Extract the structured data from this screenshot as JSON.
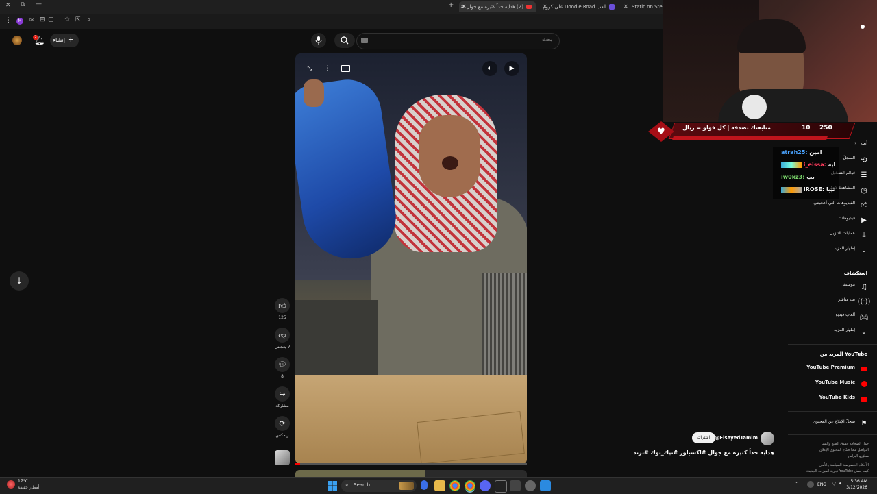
{
  "browser": {
    "tabs": [
      {
        "title": "Static on Steam"
      },
      {
        "title": "العب Doodle Road على كروم"
      },
      {
        "title": "(2) هدايه جداً كثيره مع جوال #اك..."
      }
    ],
    "new_tab": "+",
    "minimize": "—",
    "close": "✕"
  },
  "header": {
    "search_placeholder": "بحث",
    "create_label": "إنشاء",
    "notifications_count": "2"
  },
  "actions": {
    "like_count": "125",
    "dislike_label": "لا يعجبني",
    "comment_count": "8",
    "share_label": "مشاركة",
    "remix_label": "ريمكس"
  },
  "overlay": {
    "text": "متابعتك بصدقة | كل فولو = ريال",
    "count": "10",
    "total": "250"
  },
  "chat": [
    {
      "user": "atrah25:",
      "msg": "امين",
      "color": "#4aa3ff"
    },
    {
      "user": "i_eissa:",
      "msg": "ايه",
      "color": "#ff3b5c"
    },
    {
      "user": "iw0kz3:",
      "msg": "بب",
      "color": "#7bd66b"
    },
    {
      "user": "IROSE:",
      "msg": "تيبا",
      "color": "#ffffff"
    }
  ],
  "sidebar": {
    "you_label": "أنت",
    "you_items": [
      {
        "label": "السجلّ",
        "icon": "history-icon"
      },
      {
        "label": "قوائم التشغيل",
        "icon": "playlist-icon"
      },
      {
        "label": "المشاهدة لاحقًا",
        "icon": "clock-icon"
      },
      {
        "label": "الفيديوهات التي أعجبتني",
        "icon": "like-icon"
      },
      {
        "label": "فيديوهاتك",
        "icon": "video-icon"
      },
      {
        "label": "عمليات التنزيل",
        "icon": "download-icon"
      },
      {
        "label": "إظهار المزيد",
        "icon": "chevron-down-icon"
      }
    ],
    "explore_label": "استكشاف",
    "explore_items": [
      {
        "label": "موسيقى",
        "icon": "music-icon"
      },
      {
        "label": "بث مباشر",
        "icon": "live-icon"
      },
      {
        "label": "ألعاب فيديو",
        "icon": "gaming-icon"
      },
      {
        "label": "إظهار المزيد",
        "icon": "chevron-down-icon"
      }
    ],
    "more_label": "المزيد من YouTube",
    "more_items": [
      {
        "label": "YouTube Premium"
      },
      {
        "label": "YouTube Music"
      },
      {
        "label": "YouTube Kids"
      }
    ],
    "report_label": "سجلّ الإبلاغ عن المحتوى",
    "footer1": "حول   الصحافة   حقوق الطبع والنشر",
    "footer2": "التواصل معنا   صنّاع المحتوى   الإعلان",
    "footer3": "مطوّرو البرامج",
    "footer4": "الأحكام   الخصوصية   السياسة والأمان",
    "footer5": "كيف يعمل YouTube   تجربة الميزات الجديدة"
  },
  "channel": {
    "handle": "@ElsayedTamim",
    "subscribe_label": "اشتراك",
    "title": "هدايه جداً كثيره مع جوال #اكسبلور #تيك_توك #ترند"
  },
  "taskbar": {
    "weather_temp": "17°C",
    "weather_desc": "أمطار خفيفة",
    "search_label": "Search",
    "lang": "ENG",
    "time": "5:36 AM",
    "date": "3/12/2026"
  }
}
